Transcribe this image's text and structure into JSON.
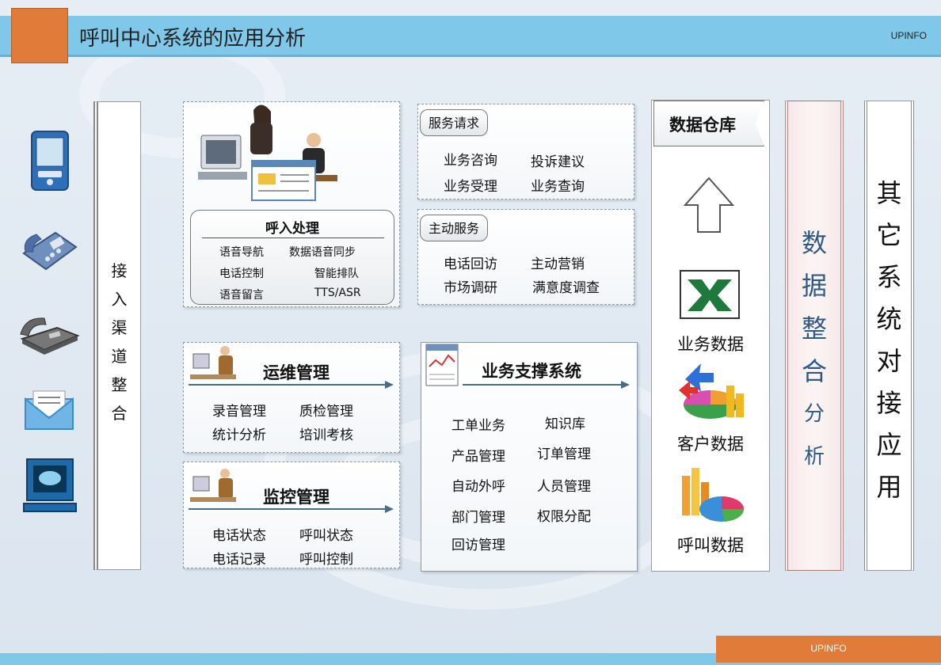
{
  "header": {
    "title": "呼叫中心系统的应用分析",
    "brand": "UPINFO"
  },
  "footer": {
    "brand": "UPINFO"
  },
  "devices": [
    "pda-icon",
    "desk-phone-icon",
    "landline-phone-icon",
    "email-envelope-icon",
    "computer-terminal-icon"
  ],
  "access": {
    "chars": [
      "接",
      "入",
      "渠",
      "道",
      "整",
      "合"
    ]
  },
  "inbound": {
    "title": "呼入处理",
    "items": [
      "语音导航",
      "数据语音同步",
      "电话控制",
      "智能排队",
      "语音留言",
      "TTS/ASR"
    ]
  },
  "service_request": {
    "tag": "服务请求",
    "items": [
      "业务咨询",
      "投诉建议",
      "业务受理",
      "业务查询"
    ]
  },
  "active_service": {
    "tag": "主动服务",
    "items": [
      "电话回访",
      "主动营销",
      "市场调研",
      "满意度调查"
    ]
  },
  "ops": {
    "title": "运维管理",
    "items": [
      "录音管理",
      "质检管理",
      "统计分析",
      "培训考核"
    ]
  },
  "monitor": {
    "title": "监控管理",
    "items": [
      "电话状态",
      "呼叫状态",
      "电话记录",
      "呼叫控制"
    ]
  },
  "support": {
    "title": "业务支撑系统",
    "items": [
      "工单业务",
      "知识库",
      "产品管理",
      "订单管理",
      "自动外呼",
      "人员管理",
      "部门管理",
      "权限分配",
      "回访管理"
    ]
  },
  "warehouse": {
    "title": "数据仓库",
    "business": "业务数据",
    "customer": "客户数据",
    "call": "呼叫数据"
  },
  "integration": {
    "chars": [
      "数",
      "据",
      "整",
      "合",
      "分",
      "析"
    ]
  },
  "other": {
    "chars": [
      "其",
      "它",
      "系",
      "统",
      "对",
      "接",
      "应",
      "用"
    ]
  },
  "colors": {
    "header": "#7fc8ea",
    "accent": "#e07b39",
    "integration_text": "#2f5a87"
  }
}
